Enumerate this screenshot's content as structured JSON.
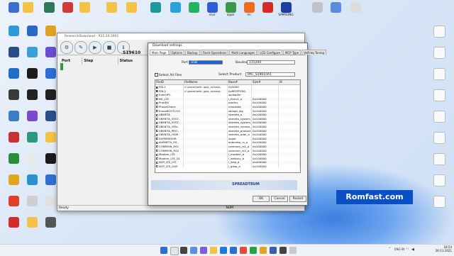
{
  "colors": {
    "accent": "#0b4fc5",
    "folder": "#f3c246"
  },
  "desktop": {
    "row_top": [
      {
        "label": "",
        "icon": "monitor-icon",
        "color": "#3c6fd1"
      },
      {
        "label": "",
        "icon": "folder-icon",
        "color": "#f3c246"
      },
      {
        "label": "",
        "icon": "app-icon",
        "color": "#2b7a55"
      },
      {
        "label": "",
        "icon": "app-icon",
        "color": "#d23a3a"
      },
      {
        "label": "",
        "icon": "folder-icon",
        "color": "#f3c246"
      },
      {
        "label": "",
        "icon": "folder-icon",
        "color": "#f3c246"
      },
      {
        "label": "",
        "icon": "folder-icon",
        "color": "#f3c246"
      },
      {
        "label": "",
        "icon": "app-icon",
        "color": "#1a9a9a"
      },
      {
        "label": "",
        "icon": "telegram-icon",
        "color": "#2aa0dc"
      },
      {
        "label": "",
        "icon": "whatsapp-icon",
        "color": "#22b35d"
      },
      {
        "label": "vivo",
        "icon": "vivo-icon",
        "color": "#2a5fd6"
      },
      {
        "label": "oppo",
        "icon": "oppo-icon",
        "color": "#3a9a4a"
      },
      {
        "label": "mi",
        "icon": "mi-icon",
        "color": "#f06a1b"
      },
      {
        "label": "",
        "icon": "huawei-icon",
        "color": "#d42a2a"
      },
      {
        "label": "SAMSUNG",
        "icon": "samsung-icon",
        "color": "#1a3fa0"
      },
      {
        "label": "",
        "icon": "app-icon",
        "color": "#c2c2c2"
      },
      {
        "label": "",
        "icon": "app-icon",
        "color": "#5a8bdc"
      },
      {
        "label": "",
        "icon": "file-icon",
        "color": "#dddddd"
      }
    ],
    "col_left": [
      {
        "label": "",
        "icon": "app-icon",
        "color": "#2e9bd8"
      },
      {
        "label": "",
        "icon": "app-icon",
        "color": "#2a4e8a"
      },
      {
        "label": "",
        "icon": "app-icon",
        "color": "#1f6fc8"
      },
      {
        "label": "",
        "icon": "app-icon",
        "color": "#3a3a3a"
      },
      {
        "label": "",
        "icon": "app-icon",
        "color": "#3a7ec2"
      },
      {
        "label": "",
        "icon": "app-icon",
        "color": "#c93030"
      },
      {
        "label": "",
        "icon": "app-icon",
        "color": "#2c8c3e"
      },
      {
        "label": "",
        "icon": "chrome-icon",
        "color": "#e3a520"
      },
      {
        "label": "",
        "icon": "app-icon",
        "color": "#e0402a"
      },
      {
        "label": "",
        "icon": "app-icon",
        "color": "#d22b2b"
      }
    ],
    "col_right": [
      {
        "label": "",
        "icon": "gear-icon"
      },
      {
        "label": "",
        "icon": "app-icon"
      },
      {
        "label": "",
        "icon": "app-icon"
      },
      {
        "label": "",
        "icon": "app-icon"
      },
      {
        "label": "",
        "icon": "app-icon"
      },
      {
        "label": "",
        "icon": "app-icon"
      },
      {
        "label": "",
        "icon": "app-icon"
      },
      {
        "label": "",
        "icon": "app-icon"
      },
      {
        "label": "",
        "icon": "app-icon"
      }
    ]
  },
  "app": {
    "title": "ResearchDownload - R25.20.3901",
    "columns": [
      "Port",
      "Step",
      "Status"
    ],
    "side_text": "S19610",
    "status_left": "Ready",
    "status_right": "NUM"
  },
  "dialog": {
    "title": "Download settings",
    "tabs": [
      "Main Page",
      "Options",
      "Backup",
      "Flash Operations",
      "Multi Languages",
      "LCD Configure",
      "MCP Type",
      "VolFreq Tuning"
    ],
    "port_label": "Port",
    "port_value": "USB",
    "baudrate_label": "Baudrate",
    "baudrate_value": "115200",
    "select_all_label": "Select All Files",
    "select_product_label": "Select Product",
    "select_product_value": "PAC_S19610A1",
    "table_headers": [
      "FileID",
      "FileName",
      "Base#",
      "Size#",
      "Bl"
    ],
    "rows": [
      {
        "checked": true,
        "id": "FDL1",
        "file": "c:\\users\\rohi..\\pac_scrossi..",
        "base": "0x5000",
        "size": ""
      },
      {
        "checked": true,
        "id": "FDL2",
        "file": "c:\\users\\rohi..\\pac_scrossi..",
        "base": "0x9EFFFE00",
        "size": ""
      },
      {
        "checked": false,
        "id": "ExecHPL",
        "file": "",
        "base": "splloader",
        "size": ""
      },
      {
        "checked": false,
        "id": "NV_LTE",
        "file": "",
        "base": "l_fixnv1_a",
        "size": "0x100000"
      },
      {
        "checked": false,
        "id": "ProdNV",
        "file": "",
        "base": "prodnv",
        "size": "0x100000"
      },
      {
        "checked": false,
        "id": "PhaseCheck",
        "file": "",
        "base": "miscdata",
        "size": "0x100000"
      },
      {
        "checked": false,
        "id": "EraseBOOTLOG",
        "file": "",
        "base": "sblogd_log",
        "size": "0x100000"
      },
      {
        "checked": false,
        "id": "VBMETA",
        "file": "",
        "base": "vbmeta_a",
        "size": "0x100000"
      },
      {
        "checked": false,
        "id": "VBMETA_SYST..",
        "file": "",
        "base": "vbmeta_system_a",
        "size": "0x100000"
      },
      {
        "checked": false,
        "id": "VBMETA_SYST..",
        "file": "",
        "base": "vbmeta_system_e..",
        "size": "0x100000"
      },
      {
        "checked": false,
        "id": "VBMETA_VEN..",
        "file": "",
        "base": "vbmeta_vendor_a",
        "size": "0x100000"
      },
      {
        "checked": false,
        "id": "VBMETA_PRO..",
        "file": "",
        "base": "vbmeta_product_a",
        "size": "0x100000"
      },
      {
        "checked": false,
        "id": "VBMETA_ODM",
        "file": "",
        "base": "vbmeta_odm_a",
        "size": "0x100000"
      },
      {
        "checked": false,
        "id": "SUPERVISOR",
        "file": "",
        "base": "super",
        "size": "0x100000"
      },
      {
        "checked": false,
        "id": "AVBMETA_RS..",
        "file": "",
        "base": "avbmeta_rs_a",
        "size": "0x100000"
      },
      {
        "checked": false,
        "id": "COMMON_RS1",
        "file": "",
        "base": "common_rs1_a",
        "size": "0x100000"
      },
      {
        "checked": false,
        "id": "COMMON_RS2",
        "file": "",
        "base": "common_rs2_a",
        "size": "0x100000"
      },
      {
        "checked": false,
        "id": "Modem_LTE",
        "file": "",
        "base": "l_modem_a",
        "size": "0x100000"
      },
      {
        "checked": false,
        "id": "Modem_LTE_DL",
        "file": "",
        "base": "l_deltanv_a",
        "size": "0x100000"
      },
      {
        "checked": false,
        "id": "DSP_LTE_LTE",
        "file": "",
        "base": "l_ldsp_a",
        "size": "0x400000"
      },
      {
        "checked": false,
        "id": "DSP_LTE_GGE",
        "file": "",
        "base": "l_gdsp_a",
        "size": "0x100000"
      }
    ],
    "logo": "SPREADTRUM",
    "ok": "OK",
    "cancel": "Cancel",
    "packet": "Packet"
  },
  "watermark": "Romfast.com",
  "taskbar": {
    "time": "18:54",
    "date": "26-11-2021",
    "lang": "ENG\nIN"
  }
}
